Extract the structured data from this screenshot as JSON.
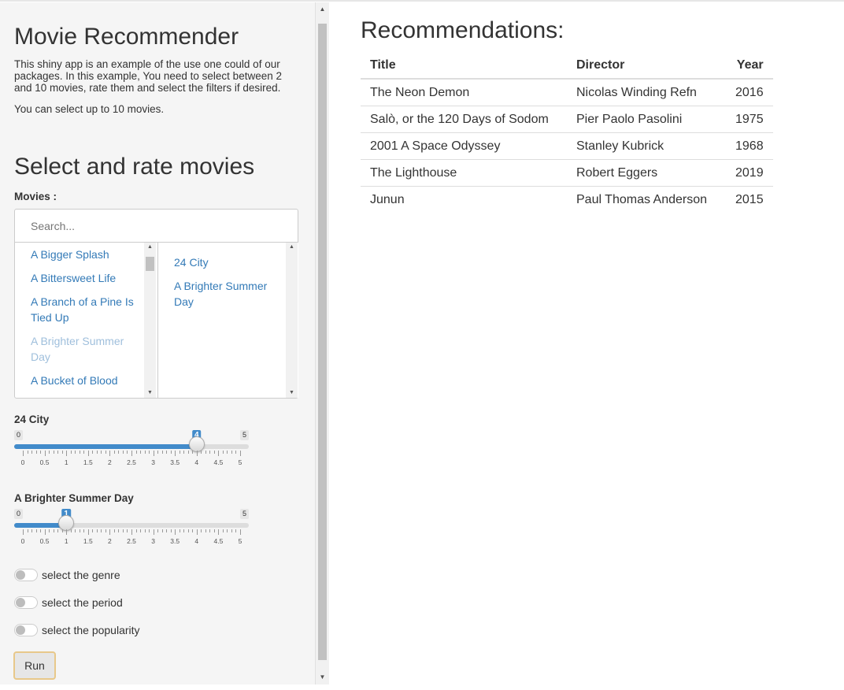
{
  "sidebar": {
    "title": "Movie Recommender",
    "description": "This shiny app is an example of the use one could of our packages. In this example, You need to select between 2 and 10 movies, rate them and select the filters if desired.",
    "limit_note": "You can select up to 10 movies.",
    "section_title": "Select and rate movies",
    "movies_label": "Movies :",
    "search_placeholder": "Search...",
    "available_movies": [
      {
        "label": "A Bigger Splash",
        "disabled": false
      },
      {
        "label": "A Bittersweet Life",
        "disabled": false
      },
      {
        "label": "A Branch of a Pine Is Tied Up",
        "disabled": false
      },
      {
        "label": "A Brighter Summer Day",
        "disabled": true
      },
      {
        "label": "A Bucket of Blood",
        "disabled": false
      }
    ],
    "selected_movies": [
      "24 City",
      "A Brighter Summer Day"
    ],
    "ratings": [
      {
        "movie": "24 City",
        "min": 0,
        "max": 5,
        "value": 4,
        "min_label": "0",
        "max_label": "5",
        "value_label": "4"
      },
      {
        "movie": "A Brighter Summer Day",
        "min": 0,
        "max": 5,
        "value": 1,
        "min_label": "0",
        "max_label": "5",
        "value_label": "1"
      }
    ],
    "tick_labels": [
      "0",
      "0.5",
      "1",
      "1.5",
      "2",
      "2.5",
      "3",
      "3.5",
      "4",
      "4.5",
      "5"
    ],
    "toggles": [
      {
        "label": "select the genre",
        "on": false
      },
      {
        "label": "select the period",
        "on": false
      },
      {
        "label": "select the popularity",
        "on": false
      }
    ],
    "run_label": "Run"
  },
  "main": {
    "title": "Recommendations:",
    "columns": [
      "Title",
      "Director",
      "Year"
    ],
    "rows": [
      [
        "The Neon Demon",
        "Nicolas Winding Refn",
        "2016"
      ],
      [
        "Salò, or the 120 Days of Sodom",
        "Pier Paolo Pasolini",
        "1975"
      ],
      [
        "2001 A Space Odyssey",
        "Stanley Kubrick",
        "1968"
      ],
      [
        "The Lighthouse",
        "Robert Eggers",
        "2019"
      ],
      [
        "Junun",
        "Paul Thomas Anderson",
        "2015"
      ]
    ]
  },
  "colors": {
    "accent": "#428bca",
    "link": "#337ab7",
    "sidebar_bg": "#f5f5f5",
    "run_border": "#e8c88a"
  }
}
